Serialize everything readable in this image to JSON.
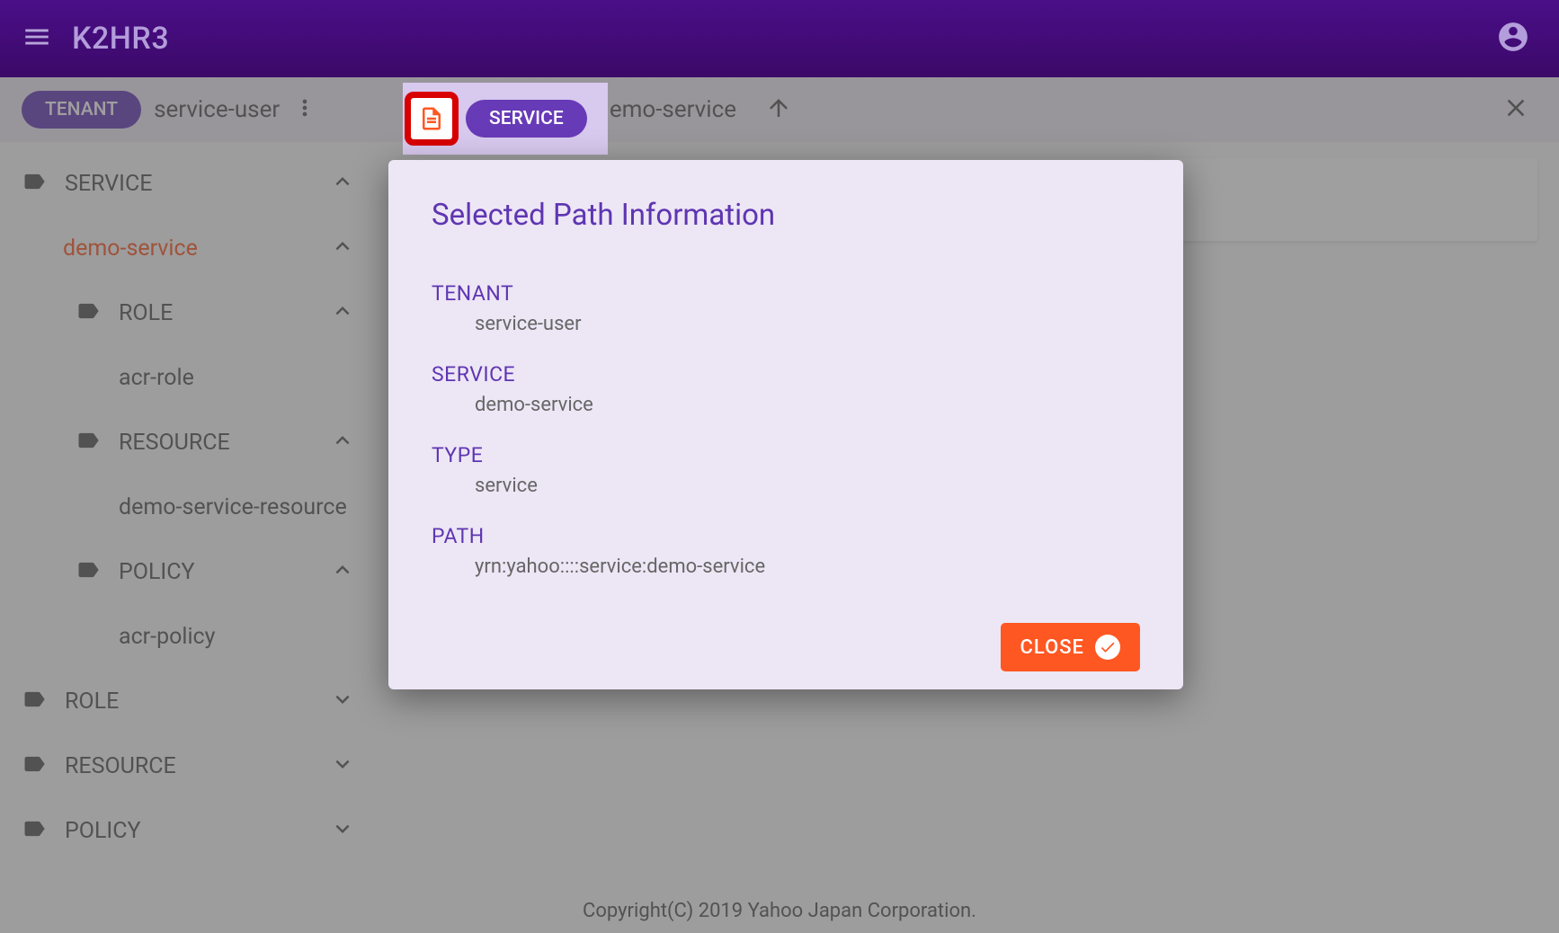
{
  "app": {
    "title": "K2HR3"
  },
  "breadcrumb": {
    "tenant_chip": "TENANT",
    "tenant_name": "service-user",
    "service_chip": "SERVICE",
    "service_name": "demo-service"
  },
  "sidebar": {
    "items": [
      {
        "label": "SERVICE",
        "level": 0,
        "hasIcon": true,
        "expanded": true,
        "hasExpand": true
      },
      {
        "label": "demo-service",
        "level": 1,
        "hasIcon": false,
        "active": true,
        "expanded": true,
        "hasExpand": true
      },
      {
        "label": "ROLE",
        "level": 2,
        "hasIcon": true,
        "expanded": true,
        "hasExpand": true
      },
      {
        "label": "acr-role",
        "level": 3,
        "hasIcon": false,
        "hasExpand": false
      },
      {
        "label": "RESOURCE",
        "level": 2,
        "hasIcon": true,
        "expanded": true,
        "hasExpand": true
      },
      {
        "label": "demo-service-resource",
        "level": 3,
        "hasIcon": false,
        "hasExpand": false
      },
      {
        "label": "POLICY",
        "level": 2,
        "hasIcon": true,
        "expanded": true,
        "hasExpand": true
      },
      {
        "label": "acr-policy",
        "level": 3,
        "hasIcon": false,
        "hasExpand": false
      },
      {
        "label": "ROLE",
        "level": 0,
        "hasIcon": true,
        "expanded": false,
        "hasExpand": true
      },
      {
        "label": "RESOURCE",
        "level": 0,
        "hasIcon": true,
        "expanded": false,
        "hasExpand": true
      },
      {
        "label": "POLICY",
        "level": 0,
        "hasIcon": true,
        "expanded": false,
        "hasExpand": true
      }
    ]
  },
  "dialog": {
    "title": "Selected Path Information",
    "fields": {
      "tenant_label": "TENANT",
      "tenant_value": "service-user",
      "service_label": "SERVICE",
      "service_value": "demo-service",
      "type_label": "TYPE",
      "type_value": "service",
      "path_label": "PATH",
      "path_value": "yrn:yahoo::::service:demo-service"
    },
    "close_button": "CLOSE"
  },
  "footer": {
    "copyright": "Copyright(C) 2019 Yahoo Japan Corporation."
  }
}
